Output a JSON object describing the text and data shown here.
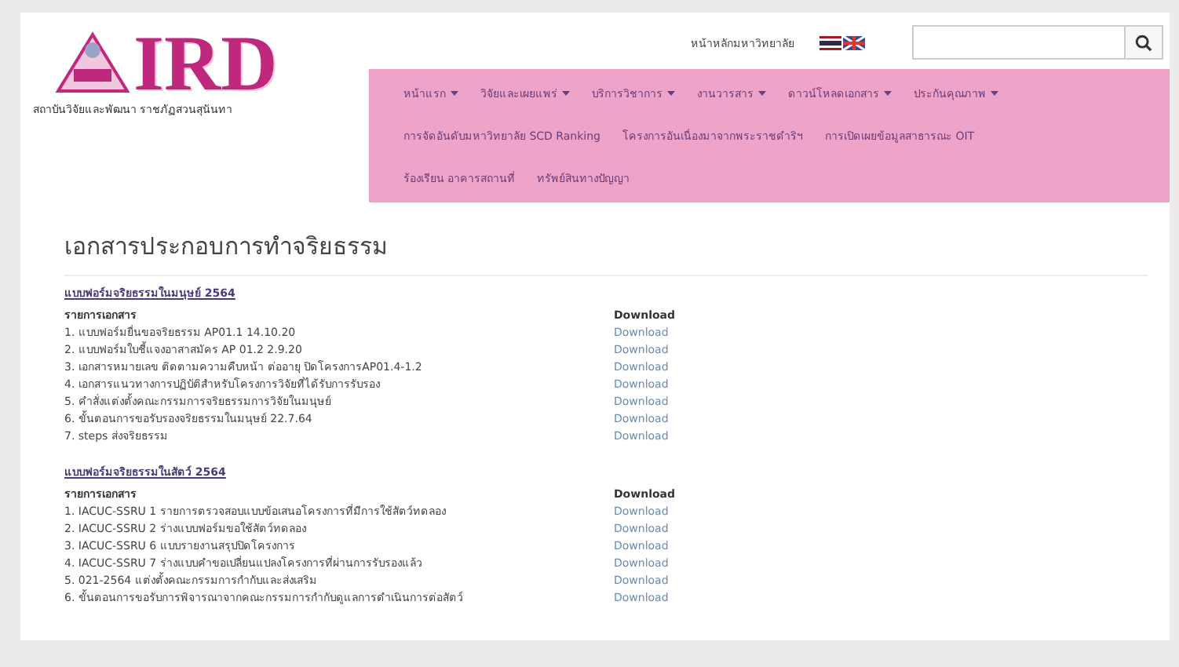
{
  "header": {
    "logo_text": "IRD",
    "subtitle": "สถาบันวิจัยและพัฒนา ราชภัฏสวนสุนันทา",
    "top_link": "หน้าหลักมหาวิทยาลัย"
  },
  "nav": [
    [
      {
        "label": "หน้าแรก",
        "dropdown": true
      },
      {
        "label": "วิจัยและเผยแพร่",
        "dropdown": true
      },
      {
        "label": "บริการวิชาการ",
        "dropdown": true
      },
      {
        "label": "งานวารสาร",
        "dropdown": true
      },
      {
        "label": "ดาวน์โหลดเอกสาร",
        "dropdown": true
      },
      {
        "label": "ประกันคุณภาพ",
        "dropdown": true
      }
    ],
    [
      {
        "label": "การจัดอันดับมหาวิทยาลัย SCD Ranking",
        "dropdown": false
      },
      {
        "label": "โครงการอันเนื่องมาจากพระราชดำริฯ",
        "dropdown": false
      },
      {
        "label": "การเปิดเผยข้อมูลสาธารณะ OIT",
        "dropdown": false
      }
    ],
    [
      {
        "label": "ร้องเรียน อาคารสถานที่",
        "dropdown": false
      },
      {
        "label": "ทรัพย์สินทางปัญญา",
        "dropdown": false
      }
    ]
  ],
  "page_title": "เอกสารประกอบการทำจริยธรรม",
  "sections": [
    {
      "heading": "แบบฟอร์มจริยธรรมในมนุษย์ 2564",
      "columns": [
        "รายการเอกสาร",
        "Download"
      ],
      "rows": [
        {
          "name": "1. แบบฟอร์มยื่นขอจริยธรรม AP01.1 14.10.20",
          "link": "Download"
        },
        {
          "name": "2. แบบฟอร์มใบชี้แจงอาสาสมัคร AP 01.2 2.9.20",
          "link": "Download"
        },
        {
          "name": "3. เอกสารหมายเลข ติดตามความคืบหน้า ต่ออายุ ปิดโครงการAP01.4-1.2",
          "link": "Download"
        },
        {
          "name": "4. เอกสารแนวทางการปฏิบัติสำหรับโครงการวิจัยที่ได้รับการรับรอง",
          "link": "Download"
        },
        {
          "name": "5. คำสั่งแต่งตั้งคณะกรรมการจริยธรรมการวิจัยในมนุษย์",
          "link": "Download"
        },
        {
          "name": "6. ขั้นตอนการขอรับรองจริยธรรมในมนุษย์ 22.7.64",
          "link": "Download"
        },
        {
          "name": "7. steps ส่งจริยธรรม",
          "link": "Download"
        }
      ]
    },
    {
      "heading": "แบบฟอร์มจริยธรรมในสัตว์ 2564",
      "columns": [
        "รายการเอกสาร",
        "Download"
      ],
      "rows": [
        {
          "name": "1. IACUC-SSRU 1 รายการตรวจสอบแบบข้อเสนอโครงการที่มีการใช้สัตว์ทดลอง",
          "link": "Download"
        },
        {
          "name": "2. IACUC-SSRU 2 ร่างแบบฟอร์มขอใช้สัตว์ทดลอง",
          "link": "Download"
        },
        {
          "name": "3. IACUC-SSRU 6 แบบรายงานสรุปปิดโครงการ",
          "link": "Download"
        },
        {
          "name": "4. IACUC-SSRU 7 ร่างแบบคำขอเปลี่ยนแปลงโครงการที่ผ่านการรับรองแล้ว",
          "link": "Download"
        },
        {
          "name": "5. 021-2564 แต่งตั้งคณะกรรมการกำกับและส่งเสริม",
          "link": "Download"
        },
        {
          "name": "6. ขั้นตอนการขอรับการพิจารณาจากคณะกรรมการกำกับดูแลการดำเนินการต่อสัตว์",
          "link": "Download"
        }
      ]
    }
  ]
}
